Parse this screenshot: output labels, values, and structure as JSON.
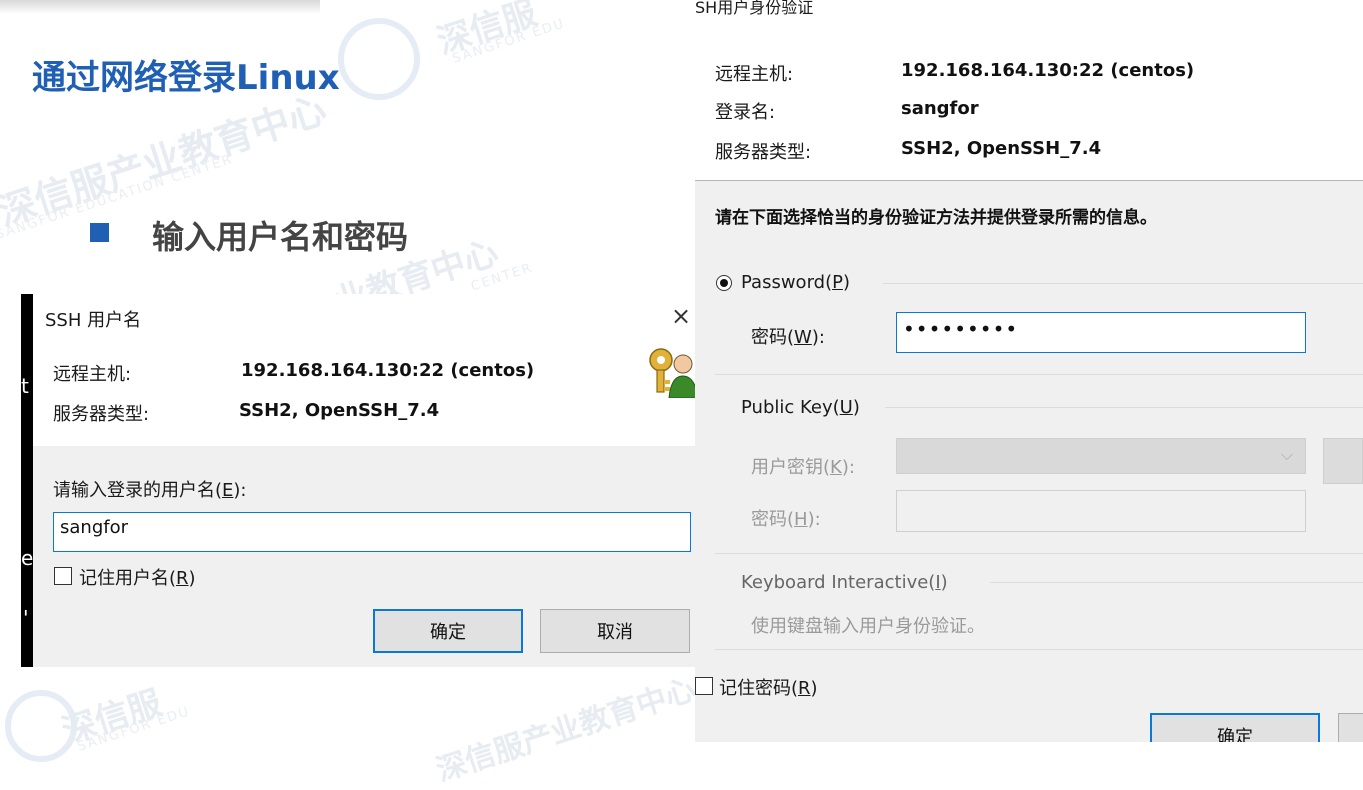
{
  "slide": {
    "title": "通过网络登录Linux",
    "bullet": "输入用户名和密码",
    "watermark_cn_1": "深信服产业教育中心",
    "watermark_en_1": "SANGFOR EDUCATION CENTER",
    "watermark_cn_2": "深信服产业教育中心",
    "watermark_en_2": "SANGFOR EDUCATION CENTER",
    "watermark_cn_3": "深信服",
    "watermark_en_3": "SANGFOR EDU",
    "watermark_cn_4": "深信服",
    "watermark_en_4": "SANGFOR EDU",
    "watermark_cn_5": "业教育中心",
    "watermark_en_5": "CENTER"
  },
  "dialog_username": {
    "title": "SSH 用户名",
    "close_glyph": "×",
    "remote_host_label": "远程主机:",
    "remote_host_value": "192.168.164.130:22 (centos)",
    "server_type_label": "服务器类型:",
    "server_type_value": "SSH2, OpenSSH_7.4",
    "prompt_text": "请输入登录的用户名(",
    "prompt_key": "E",
    "prompt_suffix": "):",
    "username_value": "sangfor",
    "remember_text": "记住用户名(",
    "remember_key": "R",
    "remember_suffix": ")",
    "ok_label": "确定",
    "cancel_label": "取消",
    "edge_fragments": [
      "t",
      "e",
      "'"
    ],
    "key_icon": "keys-user-icon"
  },
  "dialog_auth": {
    "title": "SH用户身份验证",
    "remote_host_label": "远程主机:",
    "remote_host_value": "192.168.164.130:22 (centos)",
    "login_label": "登录名:",
    "login_value": "sangfor",
    "server_type_label": "服务器类型:",
    "server_type_value": "SSH2, OpenSSH_7.4",
    "instruction": "请在下面选择恰当的身份验证方法并提供登录所需的信息。",
    "password_option": "Password(",
    "password_option_key": "P",
    "password_field_label": "密码(",
    "password_field_key": "W",
    "password_masked": "•••••••••",
    "publickey_option": "Public Key(",
    "publickey_option_key": "U",
    "user_key_label": "用户密钥(",
    "user_key_key": "K",
    "passphrase_label": "密码(",
    "passphrase_key": "H",
    "keyboard_option": "Keyboard Interactive(",
    "keyboard_option_key": "I",
    "keyboard_desc": "使用键盘输入用户身份验证。",
    "remember_password": "记住密码(",
    "remember_password_key": "R",
    "ok_label": "确定"
  },
  "colors": {
    "accent": "#1f5fb4",
    "focus_blue": "#0a78d7",
    "dialog_gray": "#f0f0f0"
  }
}
